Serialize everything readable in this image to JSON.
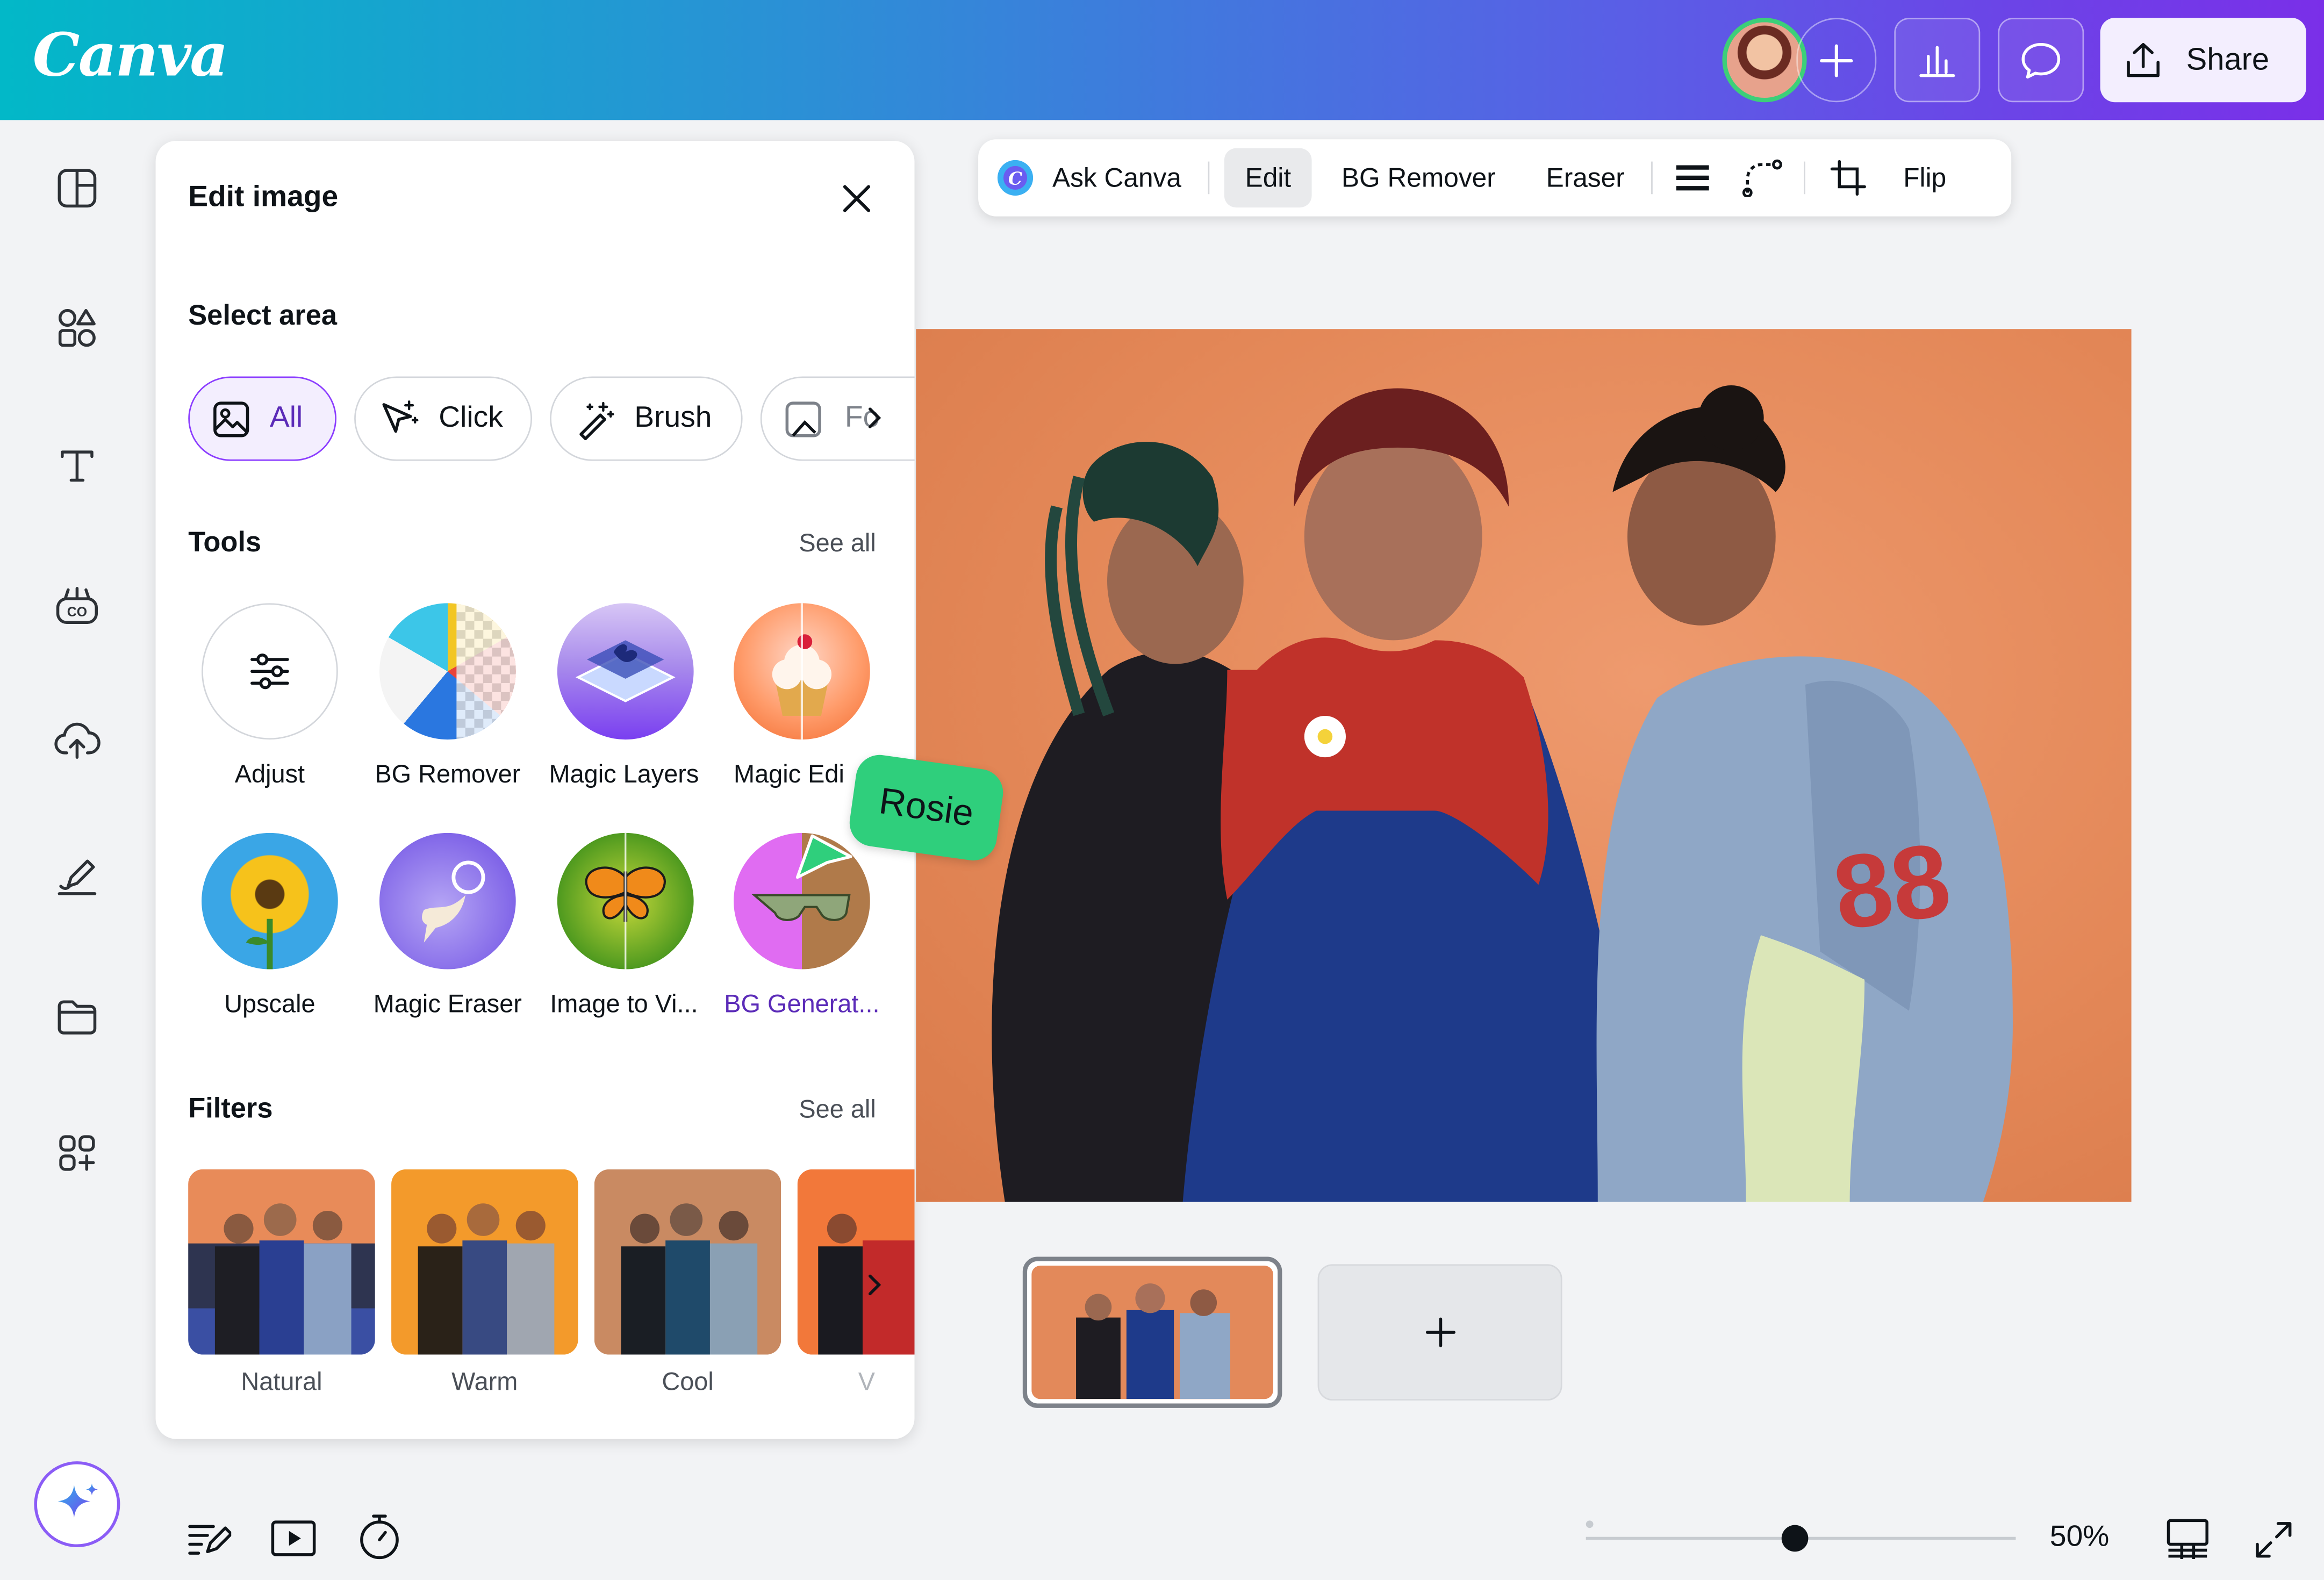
{
  "header": {
    "logo": "Canva",
    "share_label": "Share"
  },
  "rail": {
    "items": [
      "panel-icon",
      "elements-icon",
      "text-icon",
      "brand-icon",
      "upload-icon",
      "draw-icon",
      "projects-icon",
      "apps-icon"
    ]
  },
  "panel": {
    "title": "Edit image",
    "select_area_label": "Select area",
    "chips": [
      {
        "label": "All"
      },
      {
        "label": "Click"
      },
      {
        "label": "Brush"
      },
      {
        "label": "Fo"
      }
    ],
    "tools_label": "Tools",
    "tools_see_all": "See all",
    "tools": [
      {
        "label": "Adjust"
      },
      {
        "label": "BG Remover"
      },
      {
        "label": "Magic Layers"
      },
      {
        "label": "Magic Edi"
      },
      {
        "label": "Upscale"
      },
      {
        "label": "Magic Eraser"
      },
      {
        "label": "Image to Vi..."
      },
      {
        "label": "BG Generat..."
      }
    ],
    "filters_label": "Filters",
    "filters_see_all": "See all",
    "filters": [
      {
        "label": "Natural"
      },
      {
        "label": "Warm"
      },
      {
        "label": "Cool"
      },
      {
        "label": "V"
      }
    ]
  },
  "context_toolbar": {
    "ask_canva": "Ask Canva",
    "edit": "Edit",
    "bg_remover": "BG Remover",
    "eraser": "Eraser",
    "flip": "Flip"
  },
  "collaborator_tag": "Rosie",
  "footer": {
    "zoom": "50%",
    "zoom_level": 0.5
  },
  "colors": {
    "accent": "#8b3dff",
    "header_start": "#02b8c8",
    "header_end": "#7a2fe8",
    "collab_tag": "#2fcf7c"
  }
}
